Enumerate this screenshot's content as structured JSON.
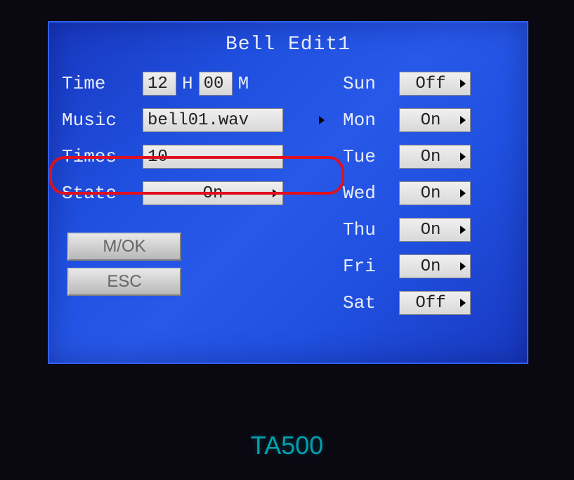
{
  "title": "Bell Edit1",
  "device_label": "TA500",
  "fields": {
    "time_label": "Time",
    "time_hour": "12",
    "time_hour_unit": "H",
    "time_min": "00",
    "time_min_unit": "M",
    "music_label": "Music",
    "music_value": "bell01.wav",
    "times_label": "Times",
    "times_value": "10",
    "state_label": "State",
    "state_value": "On"
  },
  "days": [
    {
      "label": "Sun",
      "value": "Off"
    },
    {
      "label": "Mon",
      "value": "On"
    },
    {
      "label": "Tue",
      "value": "On"
    },
    {
      "label": "Wed",
      "value": "On"
    },
    {
      "label": "Thu",
      "value": "On"
    },
    {
      "label": "Fri",
      "value": "On"
    },
    {
      "label": "Sat",
      "value": "Off"
    }
  ],
  "buttons": {
    "ok": "M/OK",
    "esc": "ESC"
  }
}
